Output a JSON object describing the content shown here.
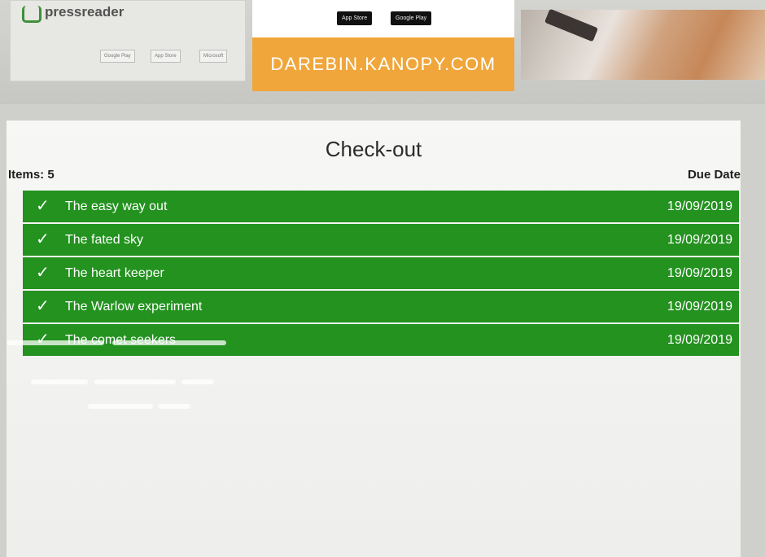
{
  "banner": {
    "pressreader_name": "pressreader",
    "pressreader_badges": [
      "Google Play",
      "App Store",
      "Microsoft"
    ],
    "kanopy_badges": [
      "App Store",
      "Google Play"
    ],
    "kanopy_url": "DAREBIN.KANOPY.COM"
  },
  "checkout": {
    "title": "Check-out",
    "items_label": "Items: 5",
    "due_header": "Due Date",
    "items": [
      {
        "title": "The easy way out",
        "due": "19/09/2019"
      },
      {
        "title": "The fated sky",
        "due": "19/09/2019"
      },
      {
        "title": "The heart keeper",
        "due": "19/09/2019"
      },
      {
        "title": "The Warlow experiment",
        "due": "19/09/2019"
      },
      {
        "title": "The comet seekers",
        "due": "19/09/2019"
      }
    ],
    "check_glyph": "✓",
    "row_color": "#23921f"
  },
  "colors": {
    "accent_orange": "#f0a63a",
    "success_green": "#23921f"
  }
}
